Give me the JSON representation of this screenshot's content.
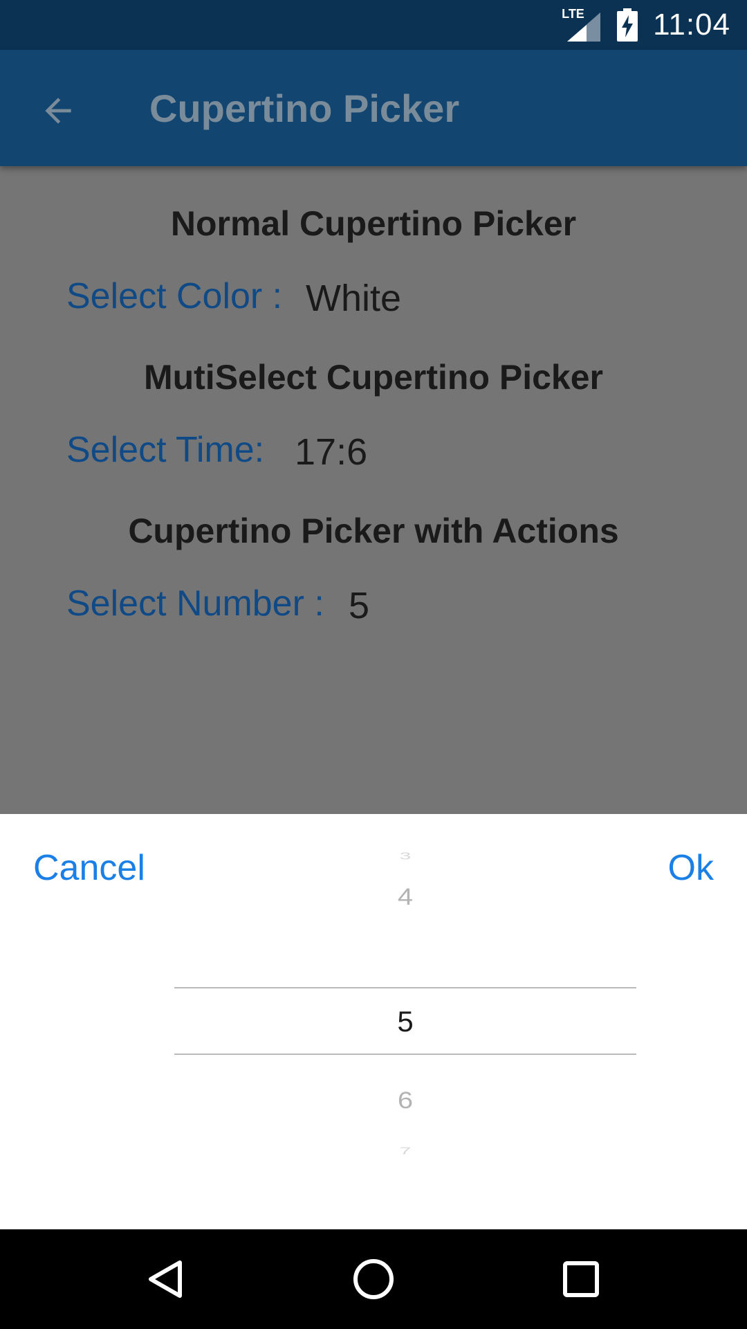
{
  "status_bar": {
    "network": "LTE",
    "time": "11:04"
  },
  "app_bar": {
    "title": "Cupertino Picker",
    "back_icon": "arrow-back-icon"
  },
  "content": {
    "sections": [
      {
        "heading": "Normal Cupertino Picker",
        "label": "Select Color :",
        "value": "White"
      },
      {
        "heading": "MutiSelect Cupertino Picker",
        "label": "Select Time:",
        "value": "17:6"
      },
      {
        "heading": "Cupertino Picker with Actions",
        "label": "Select Number :",
        "value": "5"
      }
    ]
  },
  "picker": {
    "cancel_label": "Cancel",
    "ok_label": "Ok",
    "items": [
      "3",
      "4",
      "5",
      "6",
      "7"
    ],
    "selected": "5"
  },
  "colors": {
    "status_bar": "#0c3253",
    "app_bar": "#124670",
    "scrim": "#757575",
    "label_blue": "#0f4a86",
    "action_blue": "#1a7fe6"
  },
  "nav_bar": {
    "icons": [
      "back-triangle-icon",
      "home-circle-icon",
      "recents-square-icon"
    ]
  }
}
